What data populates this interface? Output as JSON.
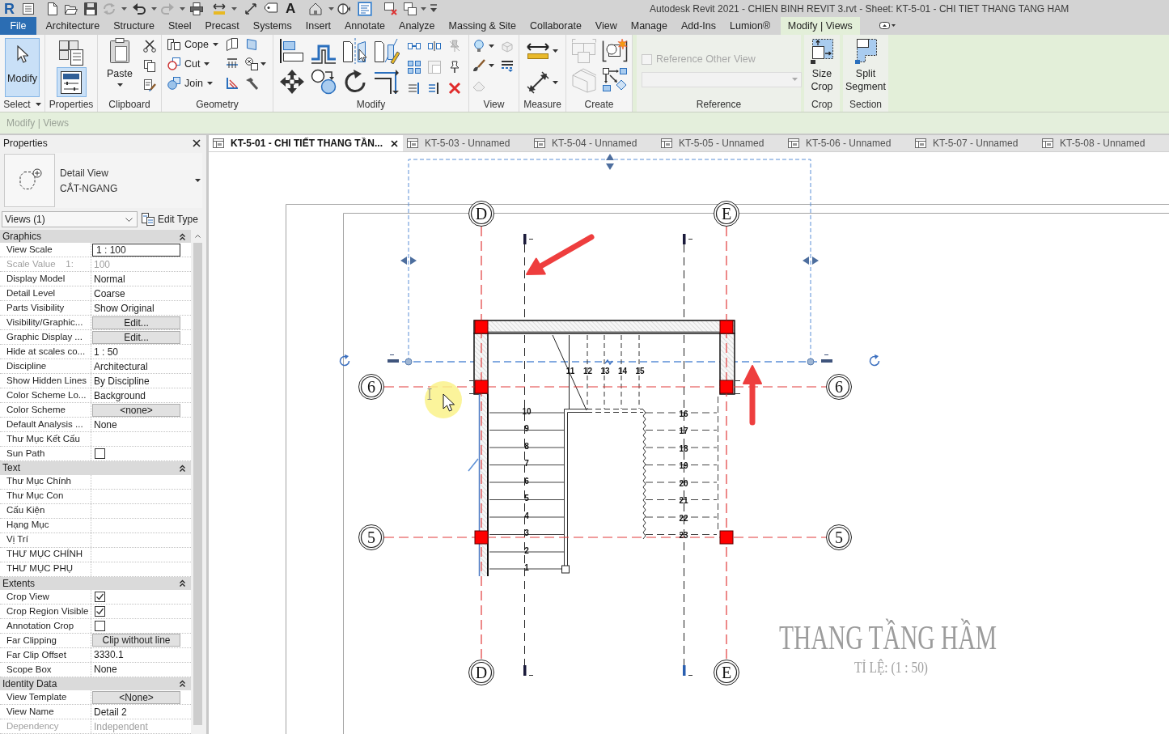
{
  "app_button": {
    "label": "R"
  },
  "quick_access_toolbar": [
    {
      "selected": false
    },
    {
      "selected": false
    },
    {
      "selected": false
    },
    {
      "selected": false
    },
    {
      "selected": false
    },
    {
      "selected": false
    },
    {
      "selected": false
    },
    {
      "selected": false
    },
    {
      "selected": false
    },
    {
      "selected": false
    },
    {
      "selected": false
    },
    {
      "label": "A",
      "selected": false
    },
    {
      "selected": false
    },
    {
      "selected": false
    },
    {
      "selected": true
    },
    {
      "selected": false
    },
    {
      "selected": false
    },
    {
      "selected": false
    }
  ],
  "window": {
    "title": "Autodesk Revit 2021 - CHIEN BINH REVIT 3.rvt - Sheet: KT-5-01 - CHI TIET THANG TANG HAM"
  },
  "ribbon_tabs": [
    {
      "label": "File",
      "kind": "file",
      "selected": false
    },
    {
      "label": "Architecture",
      "kind": "standard",
      "selected": false
    },
    {
      "label": "Structure",
      "kind": "standard",
      "selected": false
    },
    {
      "label": "Steel",
      "kind": "standard",
      "selected": false
    },
    {
      "label": "Precast",
      "kind": "standard",
      "selected": false
    },
    {
      "label": "Systems",
      "kind": "standard",
      "selected": false
    },
    {
      "label": "Insert",
      "kind": "standard",
      "selected": false
    },
    {
      "label": "Annotate",
      "kind": "standard",
      "selected": false
    },
    {
      "label": "Analyze",
      "kind": "standard",
      "selected": false
    },
    {
      "label": "Massing & Site",
      "kind": "standard",
      "selected": false
    },
    {
      "label": "Collaborate",
      "kind": "standard",
      "selected": false
    },
    {
      "label": "View",
      "kind": "standard",
      "selected": false
    },
    {
      "label": "Manage",
      "kind": "standard",
      "selected": false
    },
    {
      "label": "Add-Ins",
      "kind": "standard",
      "selected": false
    },
    {
      "label": "Lumion®",
      "kind": "standard",
      "selected": false
    },
    {
      "label": "Modify | Views",
      "kind": "contextual",
      "selected": true
    }
  ],
  "ribbon_panels": [
    {
      "label": "Select",
      "menu": true,
      "contextual": false,
      "buttons": [
        {
          "label": "Modify",
          "selected": true
        }
      ]
    },
    {
      "label": "Properties",
      "menu": false,
      "contextual": false,
      "buttons": [
        {
          "selected": false
        },
        {
          "selected": true
        }
      ]
    },
    {
      "label": "Clipboard",
      "menu": false,
      "contextual": false,
      "buttons": [
        {
          "label": "Paste"
        }
      ]
    },
    {
      "label": "Geometry",
      "menu": false,
      "contextual": false,
      "buttons": [
        {
          "label": "Cope"
        },
        {
          "label": "Cut"
        },
        {
          "label": "Join"
        }
      ]
    },
    {
      "label": "Modify",
      "menu": false,
      "contextual": false
    },
    {
      "label": "View",
      "menu": false,
      "contextual": false
    },
    {
      "label": "Measure",
      "menu": false,
      "contextual": false
    },
    {
      "label": "Create",
      "menu": false,
      "contextual": false
    },
    {
      "label": "Reference",
      "menu": false,
      "contextual": true,
      "checkbox": {
        "label": "Reference Other View",
        "checked": false,
        "disabled": true
      }
    },
    {
      "label": "Crop",
      "menu": false,
      "contextual": true,
      "buttons": [
        {
          "label": "Size Crop"
        }
      ]
    },
    {
      "label": "Section",
      "menu": false,
      "contextual": true,
      "buttons": [
        {
          "label": "Split Segment"
        }
      ]
    }
  ],
  "options_bar": {
    "label": "Modify | Views"
  },
  "properties": {
    "title": "Properties",
    "type_family": "Detail View",
    "type_name": "CẮT-NGANG",
    "filter": "Views (1)",
    "edit_type": "Edit Type",
    "groups": [
      {
        "label": "Graphics",
        "expanded": true,
        "rows": [
          {
            "label": "View Scale",
            "value": "1 : 100",
            "kind": "field"
          },
          {
            "label": "Scale Value    1:",
            "value": "100",
            "kind": "readonly"
          },
          {
            "label": "Display Model",
            "value": "Normal",
            "kind": "text"
          },
          {
            "label": "Detail Level",
            "value": "Coarse",
            "kind": "text"
          },
          {
            "label": "Parts Visibility",
            "value": "Show Original",
            "kind": "text"
          },
          {
            "label": "Visibility/Graphic...",
            "value": "Edit...",
            "kind": "button"
          },
          {
            "label": "Graphic Display ...",
            "value": "Edit...",
            "kind": "button"
          },
          {
            "label": "Hide at scales co...",
            "value": "1 : 50",
            "kind": "text"
          },
          {
            "label": "Discipline",
            "value": "Architectural",
            "kind": "text"
          },
          {
            "label": "Show Hidden Lines",
            "value": "By Discipline",
            "kind": "text"
          },
          {
            "label": "Color Scheme Lo...",
            "value": "Background",
            "kind": "text"
          },
          {
            "label": "Color Scheme",
            "value": "<none>",
            "kind": "button"
          },
          {
            "label": "Default Analysis ...",
            "value": "None",
            "kind": "text"
          },
          {
            "label": "Thư Mục Kết Cấu",
            "kind": "text"
          },
          {
            "label": "Sun Path",
            "kind": "checkbox",
            "checked": false
          }
        ]
      },
      {
        "label": "Text",
        "expanded": true,
        "rows": [
          {
            "label": "Thư Mục Chính",
            "kind": "text"
          },
          {
            "label": "Thư Mục Con",
            "kind": "text"
          },
          {
            "label": "Cấu Kiện",
            "kind": "text"
          },
          {
            "label": "Hạng Mục",
            "kind": "text"
          },
          {
            "label": "Vị Trí",
            "kind": "text"
          },
          {
            "label": "THƯ MỤC CHÍNH",
            "kind": "text"
          },
          {
            "label": "THƯ MỤC PHỤ",
            "kind": "text"
          }
        ]
      },
      {
        "label": "Extents",
        "expanded": true,
        "rows": [
          {
            "label": "Crop View",
            "kind": "checkbox",
            "checked": true
          },
          {
            "label": "Crop Region Visible",
            "kind": "checkbox",
            "checked": true
          },
          {
            "label": "Annotation Crop",
            "kind": "checkbox",
            "checked": false
          },
          {
            "label": "Far Clipping",
            "value": "Clip without line",
            "kind": "button"
          },
          {
            "label": "Far Clip Offset",
            "value": "3330.1",
            "kind": "text"
          },
          {
            "label": "Scope Box",
            "value": "None",
            "kind": "text"
          }
        ]
      },
      {
        "label": "Identity Data",
        "expanded": true,
        "rows": [
          {
            "label": "View Template",
            "value": "<None>",
            "kind": "button"
          },
          {
            "label": "View Name",
            "value": "Detail 2",
            "kind": "text"
          },
          {
            "label": "Dependency",
            "value": "Independent",
            "kind": "readonly"
          }
        ]
      }
    ]
  },
  "view_tabs": [
    {
      "label": "KT-5-01 - CHI TIẾT THANG TẦN...",
      "selected": true
    },
    {
      "label": "KT-5-03 - Unnamed",
      "selected": false
    },
    {
      "label": "KT-5-04 - Unnamed",
      "selected": false
    },
    {
      "label": "KT-5-05 - Unnamed",
      "selected": false
    },
    {
      "label": "KT-5-06 - Unnamed",
      "selected": false
    },
    {
      "label": "KT-5-07 - Unnamed",
      "selected": false
    },
    {
      "label": "KT-5-08 - Unnamed",
      "selected": false
    }
  ],
  "drawing": {
    "grid_labels": [
      "D",
      "E",
      "6",
      "6",
      "5",
      "5",
      "D",
      "E"
    ],
    "step_numbers": {
      "top_run": [
        "11",
        "12",
        "13",
        "14",
        "15"
      ],
      "left_run": [
        "10",
        "9",
        "8",
        "7",
        "6",
        "5",
        "4",
        "3",
        "2",
        "1"
      ],
      "right_run": [
        "16",
        "17",
        "18",
        "19",
        "20",
        "21",
        "22",
        "23"
      ]
    },
    "title": "THANG TẦNG HẦM",
    "scale": "TỈ LỆ: (1 : 50)"
  }
}
